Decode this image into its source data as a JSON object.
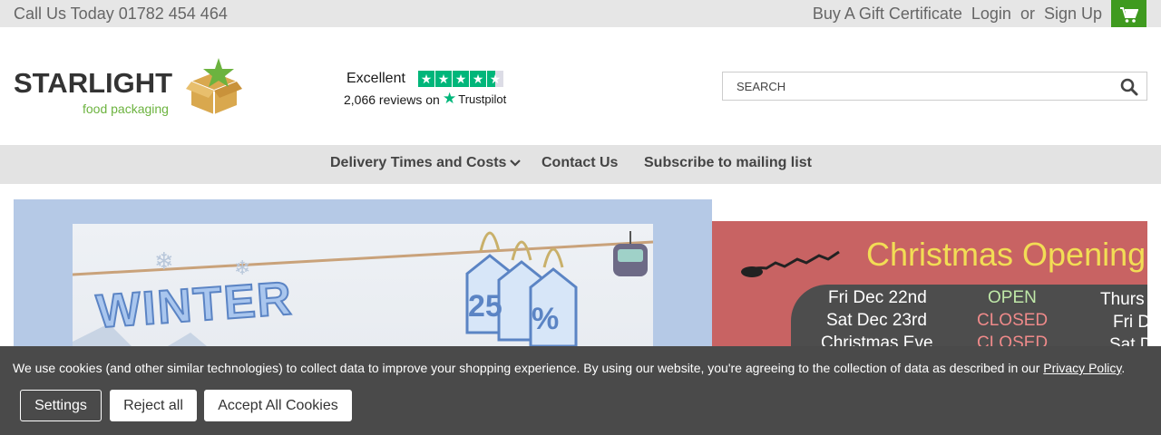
{
  "topbar": {
    "phone": "Call Us Today 01782 454 464",
    "gift": "Buy A Gift Certificate",
    "login": "Login",
    "or": "or",
    "signup": "Sign Up",
    "cart_icon": "shopping-cart-icon"
  },
  "logo": {
    "brand": "STARLIGHT",
    "sub": "food packaging",
    "icon": "star-box-icon"
  },
  "trustpilot": {
    "rating_word": "Excellent",
    "stars": 4.5,
    "reviews": "2,066 reviews on",
    "brand": "Trustpilot"
  },
  "search": {
    "placeholder": "SEARCH",
    "icon": "search-icon"
  },
  "nav": {
    "items": [
      {
        "label": "Delivery Times and Costs"
      },
      {
        "label": "Contact Us"
      },
      {
        "label": "Subscribe to mailing list"
      }
    ]
  },
  "banner_winter": {
    "headline": "WINTER",
    "tags": [
      "25",
      "%"
    ]
  },
  "banner_christmas": {
    "title": "Christmas Opening",
    "rows_left": [
      {
        "day": "Fri Dec 22nd",
        "status": "OPEN"
      },
      {
        "day": "Sat Dec 23rd",
        "status": "CLOSED"
      },
      {
        "day": "Christmas Eve",
        "status": "CLOSED"
      }
    ],
    "rows_right": [
      "Thurs",
      "Fri D",
      "Sat D"
    ]
  },
  "cookie": {
    "message": "We use cookies (and other similar technologies) to collect data to improve your shopping experience. By using our website, you're agreeing to the collection of data as described in our",
    "policy_link": "Privacy Policy",
    "period": ".",
    "settings": "Settings",
    "reject": "Reject all",
    "accept": "Accept All Cookies"
  },
  "colors": {
    "brand_green": "#3f9a1f",
    "trustpilot_green": "#00b67a",
    "cookie_bg": "#4a4a4a",
    "christmas_bg": "#c86363",
    "christmas_title": "#f2dd55"
  }
}
